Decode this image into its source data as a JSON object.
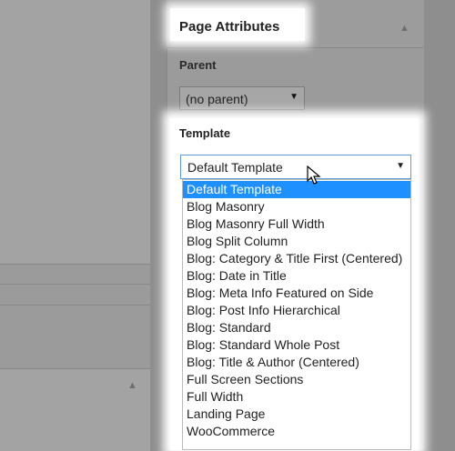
{
  "metabox": {
    "title": "Page Attributes",
    "toggle_icon": "triangle-up-icon"
  },
  "parent": {
    "label": "Parent",
    "selected": "(no parent)"
  },
  "template": {
    "label": "Template",
    "selected": "Default Template",
    "options": [
      "Default Template",
      "Blog Masonry",
      "Blog Masonry Full Width",
      "Blog Split Column",
      "Blog: Category & Title First (Centered)",
      "Blog: Date in Title",
      "Blog: Meta Info Featured on Side",
      "Blog: Post Info Hierarchical",
      "Blog: Standard",
      "Blog: Standard Whole Post",
      "Blog: Title & Author (Centered)",
      "Full Screen Sections",
      "Full Width",
      "Landing Page",
      "WooCommerce"
    ]
  },
  "colors": {
    "selection": "#1e90ff",
    "focus_border": "#5b9dd9"
  }
}
